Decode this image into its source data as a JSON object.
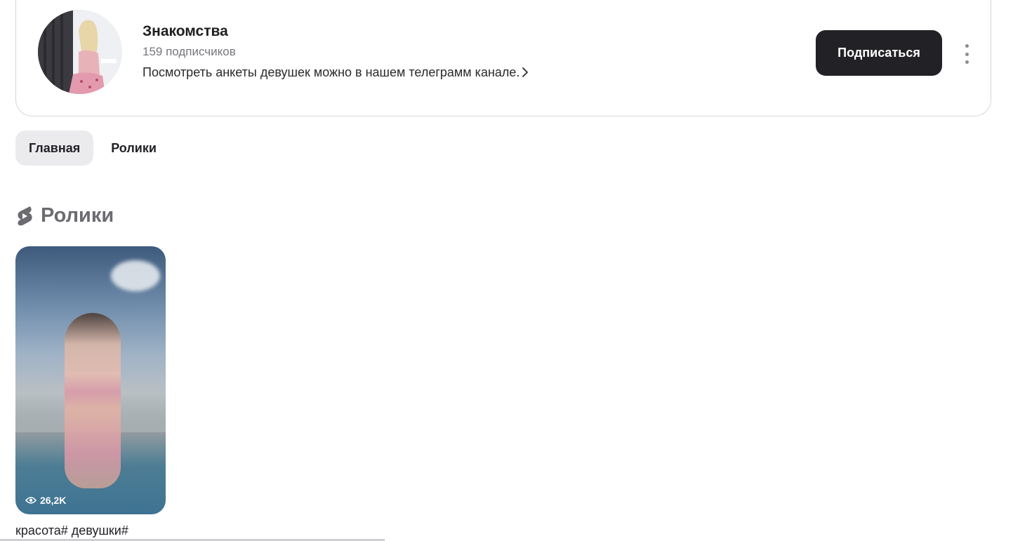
{
  "channel": {
    "name": "Знакомства",
    "subscribers": "159 подписчиков",
    "description": "Посмотреть анкеты девушек можно в нашем телеграмм канале.",
    "subscribe_label": "Подписаться",
    "avatar_icon": "channel-avatar-photo",
    "more_icon": "more-vertical-icon"
  },
  "tabs": [
    {
      "label": "Главная",
      "active": true
    },
    {
      "label": "Ролики",
      "active": false
    }
  ],
  "section": {
    "title": "Ролики",
    "icon": "shorts-icon"
  },
  "videos": [
    {
      "title": "красота# девушки#",
      "views": "26,2K",
      "views_icon": "eye-icon"
    }
  ],
  "colors": {
    "button_bg": "#222226",
    "button_text": "#ffffff",
    "tab_active_bg": "#ebebee",
    "section_title": "#6b6b70",
    "subtext": "#77777c"
  }
}
